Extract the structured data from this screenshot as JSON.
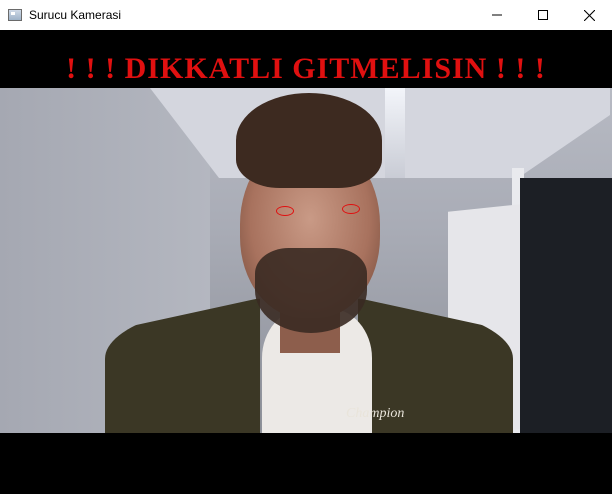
{
  "window": {
    "title": "Surucu Kamerasi",
    "icon": "app-window-icon",
    "controls": {
      "minimize_icon": "minimize-icon",
      "maximize_icon": "maximize-icon",
      "close_icon": "close-icon"
    }
  },
  "overlay": {
    "alert_text": "! ! ! DIKKATLI GITMELISIN ! ! !",
    "alert_color": "#e01010",
    "eye_marker_color": "#e01010"
  },
  "feed": {
    "shirt_logo_text": "Champion"
  }
}
